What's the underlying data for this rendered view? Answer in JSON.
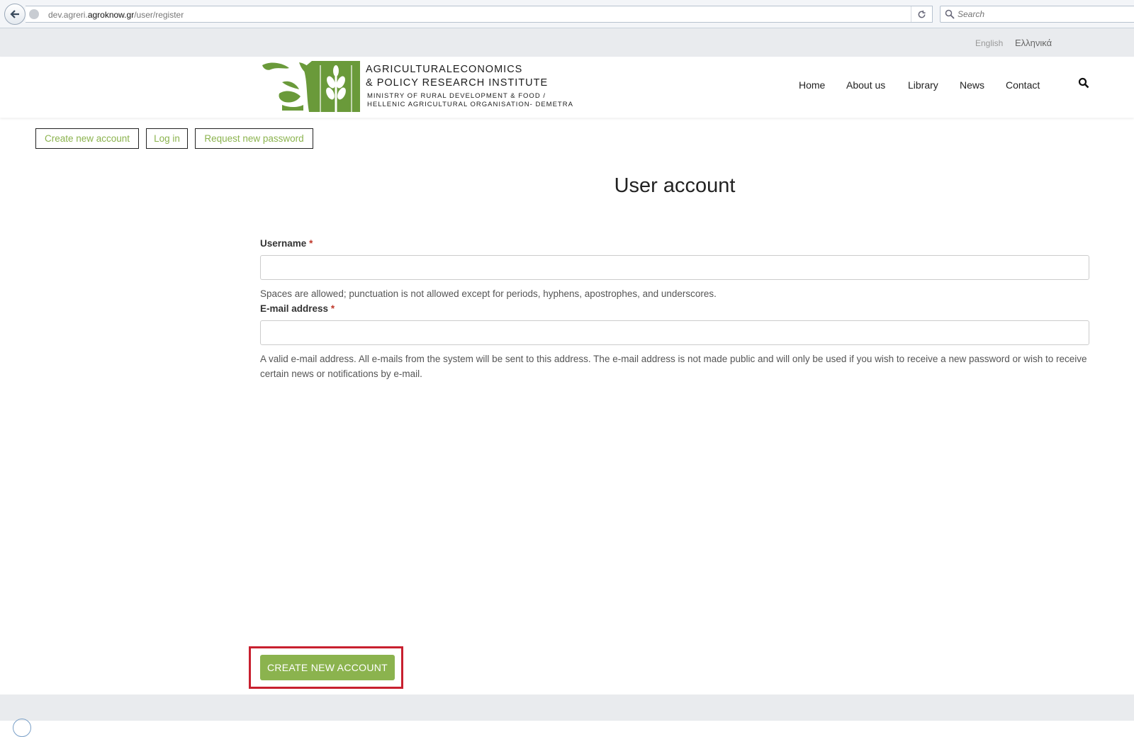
{
  "browser": {
    "url_prefix": "dev.agreri.",
    "url_host": "agroknow.gr",
    "url_path": "/user/register",
    "search_placeholder": "Search"
  },
  "languages": {
    "english": "English",
    "greek": "Ελληνικά"
  },
  "logo": {
    "title_line1": "AGRICULTURALECONOMICS",
    "title_line2": "& POLICY RESEARCH INSTITUTE",
    "subtitle_line1": "MINISTRY OF RURAL DEVELOPMENT & FOOD /",
    "subtitle_line2": "HELLENIC AGRICULTURAL ORGANISATION- DEMETRA",
    "brand_color": "#6a9a3a"
  },
  "nav": {
    "home": "Home",
    "about": "About us",
    "library": "Library",
    "news": "News",
    "contact": "Contact"
  },
  "tabs": {
    "create": "Create new account",
    "login": "Log in",
    "password": "Request new password"
  },
  "page": {
    "title": "User account"
  },
  "form": {
    "username_label": "Username",
    "required_mark": "*",
    "username_value": "",
    "username_help": "Spaces are allowed; punctuation is not allowed except for periods, hyphens, apostrophes, and underscores.",
    "email_label": "E-mail address",
    "email_value": "",
    "email_help": "A valid e-mail address. All e-mails from the system will be sent to this address. The e-mail address is not made public and will only be used if you wish to receive a new password or wish to receive certain news or notifications by e-mail.",
    "submit_label": "CREATE NEW ACCOUNT"
  },
  "colors": {
    "accent_green": "#8bb34e",
    "highlight_red": "#c8202f"
  }
}
